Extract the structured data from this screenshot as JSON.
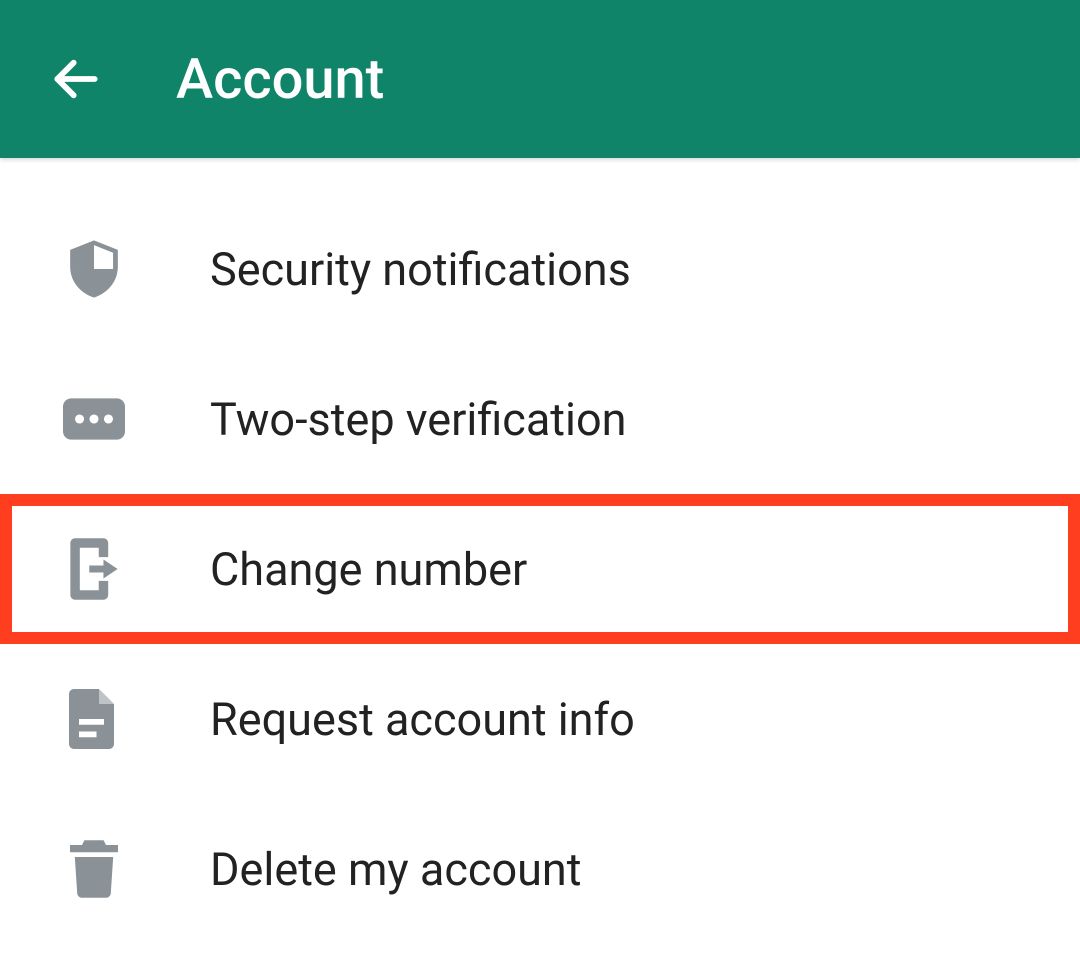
{
  "header": {
    "title": "Account"
  },
  "menu": {
    "items": [
      {
        "label": "Security notifications",
        "icon": "shield-icon",
        "highlighted": false
      },
      {
        "label": "Two-step verification",
        "icon": "password-icon",
        "highlighted": false
      },
      {
        "label": "Change number",
        "icon": "change-number-icon",
        "highlighted": true
      },
      {
        "label": "Request account info",
        "icon": "document-icon",
        "highlighted": false
      },
      {
        "label": "Delete my account",
        "icon": "trash-icon",
        "highlighted": false
      }
    ]
  }
}
